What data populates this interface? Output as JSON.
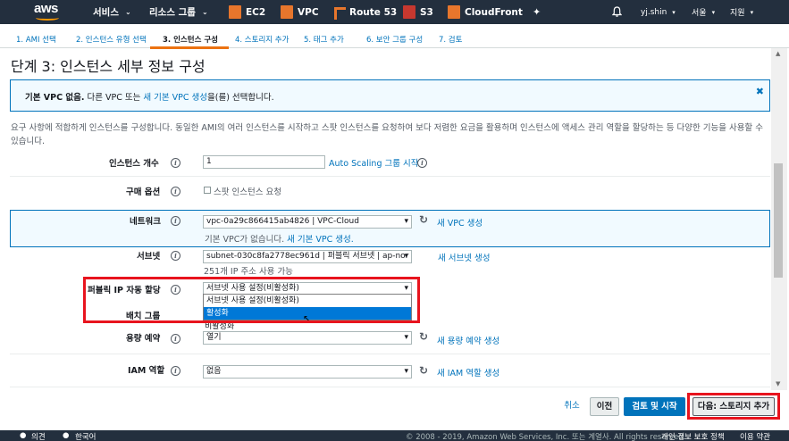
{
  "topnav": {
    "logo": "aws",
    "services": "서비스",
    "resource_groups": "리소스 그룹",
    "shortcuts": [
      "EC2",
      "VPC",
      "Route 53",
      "S3",
      "CloudFront"
    ],
    "user": "yj.shin",
    "region": "서울",
    "support": "지원"
  },
  "steps": [
    "1. AMI 선택",
    "2. 인스턴스 유형 선택",
    "3. 인스턴스 구성",
    "4. 스토리지 추가",
    "5. 태그 추가",
    "6. 보안 그룹 구성",
    "7. 검토"
  ],
  "page_title": "단계 3: 인스턴스 세부 정보 구성",
  "banner": {
    "bold": "기본 VPC 없음.",
    "text1": " 다른 VPC 또는 ",
    "link": "새 기본 VPC 생성",
    "text2": "을(를) 선택합니다."
  },
  "description": "요구 사항에 적합하게 인스턴스를 구성합니다. 동일한 AMI의 여러 인스턴스를 시작하고 스팟 인스턴스를 요청하여 보다 저렴한 요금을 활용하며 인스턴스에 액세스 관리 역할을 할당하는 등 다양한 기능을 사용할 수 있습니다.",
  "form": {
    "instance_count_label": "인스턴스 개수",
    "instance_count_value": "1",
    "autoscaling_link": "Auto Scaling 그룹 시작",
    "purchase_label": "구매 옵션",
    "spot_label": "스팟 인스턴스 요청",
    "network_label": "네트워크",
    "network_value": "vpc-0a29c866415ab4826 | VPC-Cloud",
    "new_vpc_link": "새 VPC 생성",
    "default_vpc_text": "기본 VPC가 없습니다.",
    "default_vpc_link": "새 기본 VPC 생성.",
    "subnet_label": "서브넷",
    "subnet_value": "subnet-030c8fa2778ec961d | 퍼블릭 서브넷 | ap-nor",
    "subnet_ips": "251개 IP 주소 사용 가능",
    "new_subnet_link": "새 서브넷 생성",
    "public_ip_label": "퍼블릭 IP 자동 할당",
    "public_ip_value": "서브넷 사용 설정(비활성화)",
    "public_ip_options": [
      "서브넷 사용 설정(비활성화)",
      "활성화"
    ],
    "placement_label": "배치 그룹",
    "placement_hidden": "비활성화",
    "capacity_label": "용량 예약",
    "capacity_value": "열기",
    "new_capacity_link": "새 용량 예약 생성",
    "iam_label": "IAM 역할",
    "iam_value": "없음",
    "new_iam_link": "새 IAM 역할 생성"
  },
  "buttons": {
    "cancel": "취소",
    "previous": "이전",
    "review": "검토 및 시작",
    "next": "다음: 스토리지 추가"
  },
  "footer": {
    "feedback": "의견",
    "language": "한국어",
    "copyright": "© 2008 - 2019, Amazon Web Services, Inc. 또는 계열사. All rights reserved.",
    "privacy": "개인 정보 보호 정책",
    "terms": "이용 약관"
  },
  "colors": {
    "nav_bg": "#232f3e",
    "accent_orange": "#ec7211",
    "link_blue": "#0073bb",
    "highlight_red": "#e8141e"
  }
}
